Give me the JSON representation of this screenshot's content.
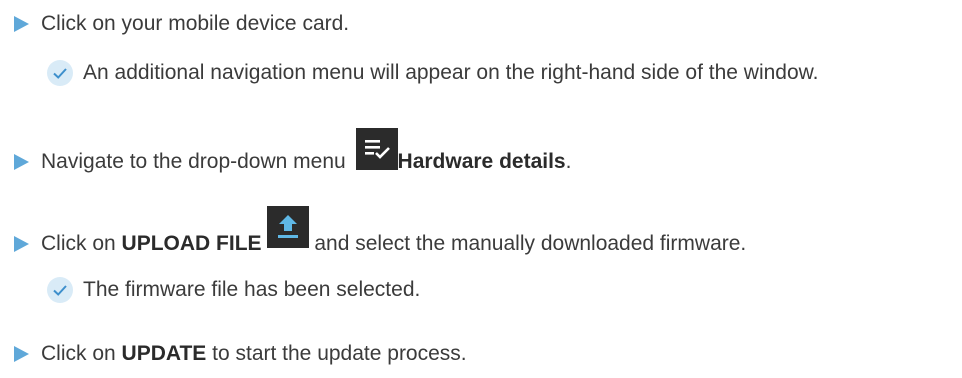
{
  "steps": [
    {
      "text": "Click on your mobile device card.",
      "result": "An additional navigation menu will appear on the right-hand side of the window."
    },
    {
      "text_before": "Navigate to the drop-down menu ",
      "icon": "checklist-menu-icon",
      "bold": "Hardware details",
      "text_after": "."
    },
    {
      "text_before": "Click on ",
      "bold": "UPLOAD FILE",
      "icon": "upload-icon",
      "text_after": " and select the manually downloaded firmware.",
      "result": "The firmware file has been selected."
    },
    {
      "text_before": "Click on ",
      "bold": "UPDATE",
      "text_after": " to start the update process."
    }
  ],
  "colors": {
    "bullet": "#5fa8d9",
    "check_bg": "#d9ebf7",
    "check_stroke": "#3d8fcc",
    "upload_icon": "#5fb8e6",
    "icon_bg": "#2b2b2b"
  }
}
